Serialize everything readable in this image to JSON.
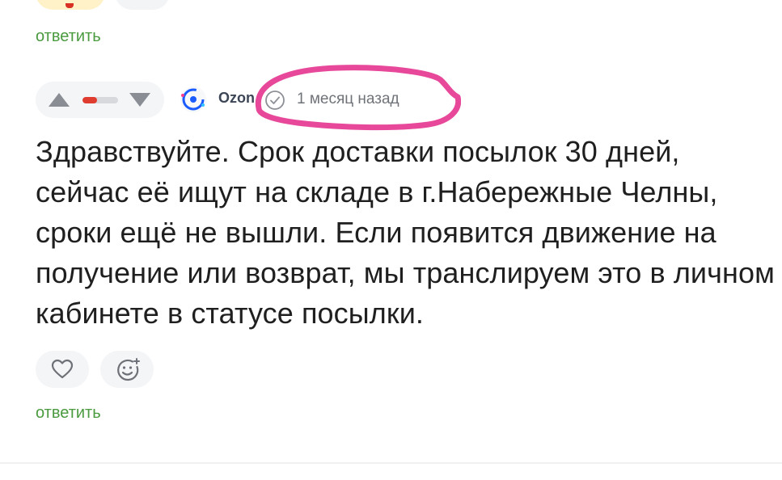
{
  "previous_comment": {
    "reply_label": "ответить"
  },
  "comment": {
    "vote": {
      "up_icon": "triangle-up",
      "down_icon": "triangle-down",
      "rating_fraction": 0.4,
      "rating_color": "#e03b2f"
    },
    "author": {
      "name": "Ozon",
      "avatar_icon": "ozon-logo",
      "verified_icon": "check-circle"
    },
    "time": "1 месяц назад",
    "text": "Здравствуйте. Срок доставки посылок 30 дней, сейчас её ищут на складе в г.Набережные Челны, сроки ещё не вышли. Если появится движение на получение или возврат, мы транслируем это в личном кабинете в статусе посылки.",
    "reactions": {
      "like_icon": "heart",
      "emoji_icon": "smiley-plus"
    },
    "reply_label": "ответить"
  },
  "colors": {
    "link_green": "#4a9a3f",
    "highlight_pink": "#e8489a"
  }
}
